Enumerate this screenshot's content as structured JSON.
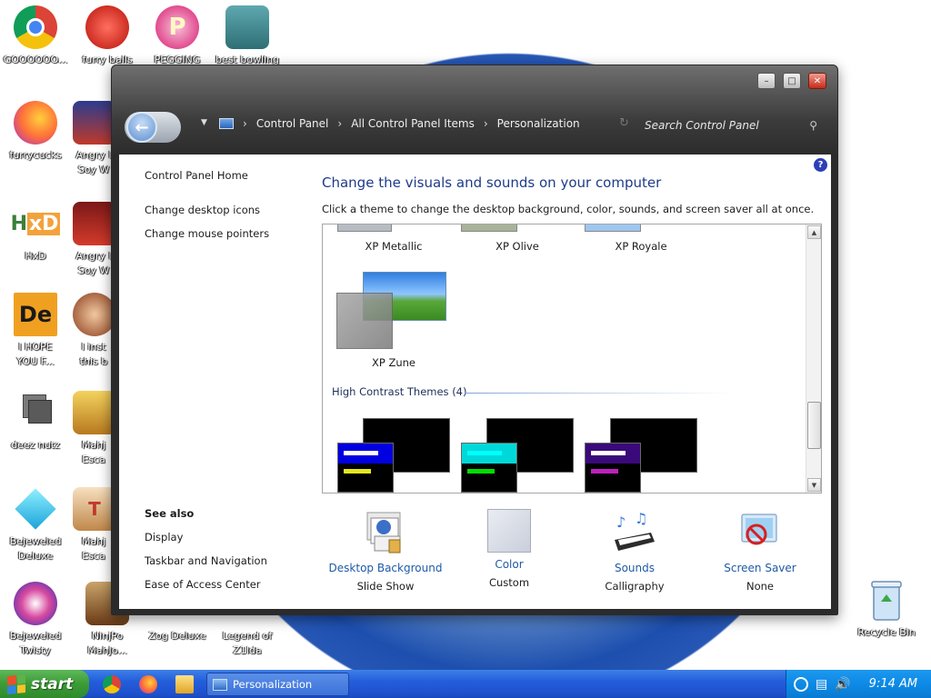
{
  "desktop": {
    "icons": [
      {
        "label": "GOOOOOO..."
      },
      {
        "label": "furry balls"
      },
      {
        "label": "PEGGING"
      },
      {
        "label": "best bowling"
      },
      {
        "label": "furrycucks"
      },
      {
        "label": "Angry I\nSoy W"
      },
      {
        "label": "HxD"
      },
      {
        "label": "Angry I\nSoy W"
      },
      {
        "label": "I HOPE\nYOU F..."
      },
      {
        "label": "I inst\nthis b"
      },
      {
        "label": "deez nutz"
      },
      {
        "label": "Mahj\nEsca"
      },
      {
        "label": "Bejeweled\nDeluxe"
      },
      {
        "label": "Mahj\nEsca"
      },
      {
        "label": "Bejeweled\nTwisty"
      },
      {
        "label": "NinjPo\nMahJo..."
      },
      {
        "label": "Zog Deluxe"
      },
      {
        "label": "Legend of\nZ1lda"
      },
      {
        "label": "Recycle Bin"
      }
    ]
  },
  "window": {
    "breadcrumb": [
      "Control Panel",
      "All Control Panel Items",
      "Personalization"
    ],
    "search_placeholder": "Search Control Panel",
    "title_buttons": {
      "minimize": "–",
      "maximize": "□",
      "close": "✕"
    }
  },
  "left_pane": {
    "home_link": "Control Panel Home",
    "links": [
      "Change desktop icons",
      "Change mouse pointers"
    ],
    "see_also_header": "See also",
    "see_also": [
      "Display",
      "Taskbar and Navigation",
      "Ease of Access Center"
    ]
  },
  "main": {
    "title": "Change the visuals and sounds on your computer",
    "description": "Click a theme to change the desktop background, color, sounds, and screen saver all at once.",
    "themes_row1": [
      "XP Metallic",
      "XP Olive",
      "XP Royale"
    ],
    "theme_zune": "XP Zune",
    "high_contrast_header": "High Contrast Themes (4)",
    "high_contrast_colors": [
      "#0000e0",
      "#00d8d8",
      "#3a0a7a"
    ],
    "high_contrast_bar_colors": [
      {
        "bar1": "#ffffff",
        "bar2": "#e6e61e"
      },
      {
        "bar1": "#00ffff",
        "bar2": "#00e000"
      },
      {
        "bar1": "#ffffff",
        "bar2": "#c020c0"
      }
    ],
    "bottom_items": [
      {
        "label": "Desktop Background",
        "sub": "Slide Show",
        "icon": "desktop-background-icon"
      },
      {
        "label": "Color",
        "sub": "Custom",
        "icon": "color-swatch-icon"
      },
      {
        "label": "Sounds",
        "sub": "Calligraphy",
        "icon": "sounds-icon"
      },
      {
        "label": "Screen Saver",
        "sub": "None",
        "icon": "screen-saver-icon"
      }
    ]
  },
  "taskbar": {
    "start_label": "start",
    "task_button": "Personalization",
    "clock": "9:14 AM"
  }
}
